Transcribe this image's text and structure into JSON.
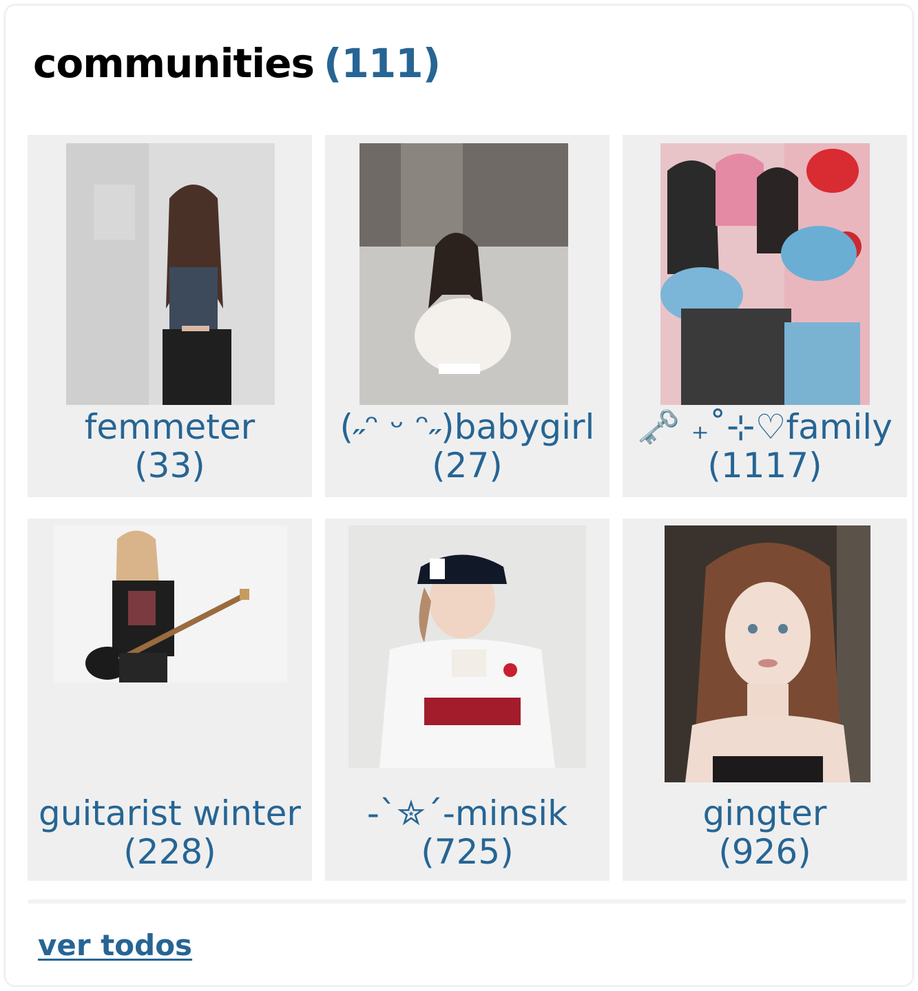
{
  "header": {
    "title": "communities",
    "count": "(111)"
  },
  "communities": [
    {
      "name": "femmeter",
      "count": "(33)"
    },
    {
      "name": "(˶ᵔ ᵕ ᵔ˶)babygirl",
      "count": "(27)"
    },
    {
      "name": "🗝️ ₊˚⊹♡family",
      "count": "(1117)"
    },
    {
      "name": "guitarist winter",
      "count": "(228)"
    },
    {
      "name": "-ˋ✮ˊ-minsik",
      "count": "(725)"
    },
    {
      "name": "gingter",
      "count": "(926)"
    }
  ],
  "footer": {
    "see_all_label": "ver todos"
  },
  "colors": {
    "accent": "#266594",
    "title": "#000000",
    "card_bg": "#efefef"
  }
}
